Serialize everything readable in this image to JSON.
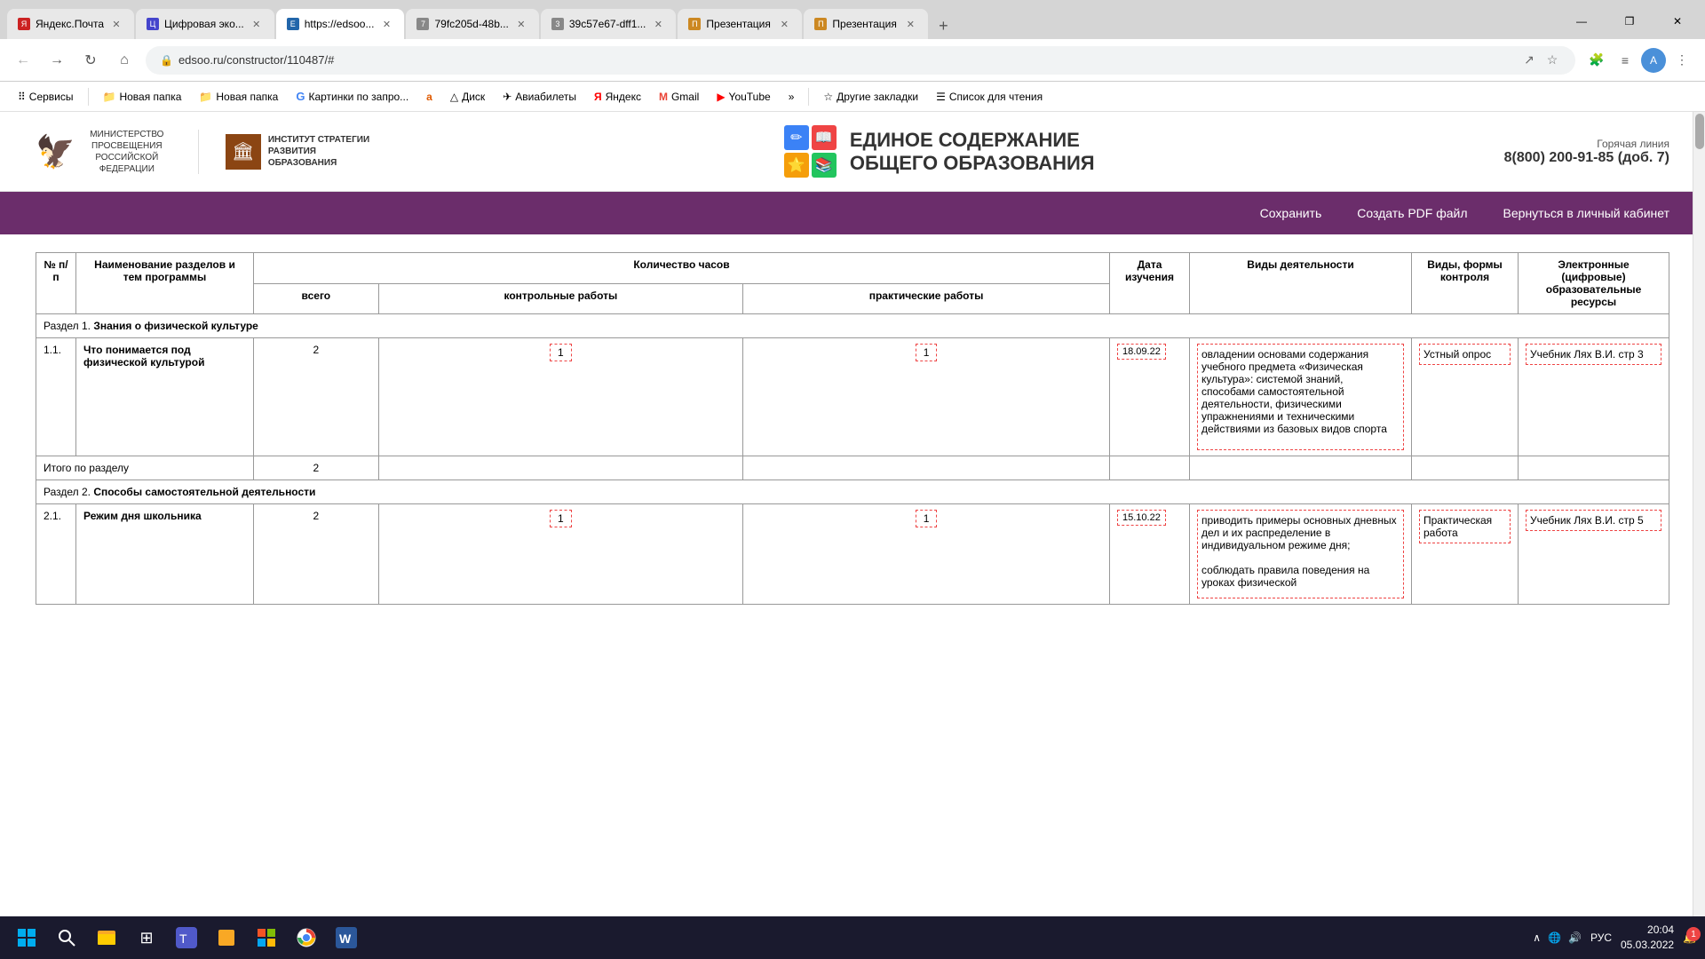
{
  "browser": {
    "tabs": [
      {
        "id": "tab1",
        "title": "Яндекс.Почта",
        "favicon_color": "#cc2222",
        "favicon_char": "Я",
        "active": false
      },
      {
        "id": "tab2",
        "title": "Цифровая эко...",
        "favicon_color": "#4444cc",
        "favicon_char": "Ц",
        "active": false
      },
      {
        "id": "tab3",
        "title": "https://edsoo...",
        "favicon_color": "#2266aa",
        "favicon_char": "E",
        "active": true
      },
      {
        "id": "tab4",
        "title": "79fc205d-48b...",
        "favicon_color": "#888888",
        "favicon_char": "7",
        "active": false
      },
      {
        "id": "tab5",
        "title": "39c57e67-dff1...",
        "favicon_color": "#888888",
        "favicon_char": "3",
        "active": false
      },
      {
        "id": "tab6",
        "title": "Презентация",
        "favicon_color": "#cc8822",
        "favicon_char": "П",
        "active": false
      },
      {
        "id": "tab7",
        "title": "Презентация",
        "favicon_color": "#cc8822",
        "favicon_char": "П",
        "active": false
      }
    ],
    "url": "edsoo.ru/constructor/110487/#",
    "win_min": "—",
    "win_max": "❐",
    "win_close": "✕"
  },
  "bookmarks": [
    {
      "label": "Сервисы",
      "icon": "⠿"
    },
    {
      "label": "Новая папка",
      "icon": "📁"
    },
    {
      "label": "Новая папка",
      "icon": "📁"
    },
    {
      "label": "Картинки по запро...",
      "icon": "G"
    },
    {
      "label": "a",
      "icon": "a"
    },
    {
      "label": "Диск",
      "icon": "△"
    },
    {
      "label": "Авиабилеты",
      "icon": "✈"
    },
    {
      "label": "Яндекс",
      "icon": "Я"
    },
    {
      "label": "Gmail",
      "icon": "M"
    },
    {
      "label": "YouTube",
      "icon": "▶"
    },
    {
      "label": "»",
      "icon": ""
    },
    {
      "label": "Другие закладки",
      "icon": "☆"
    },
    {
      "label": "Список для чтения",
      "icon": "☰"
    }
  ],
  "site": {
    "ministry_logo": "🦅",
    "ministry_text": "МИНИСТЕРСТВО ПРОСВЕЩЕНИЯ РОССИЙСКОЙ ФЕДЕРАЦИИ",
    "institute_text": "ИНСТИТУТ СТРАТЕГИИ РАЗВИТИЯ ОБРАЗОВАНИЯ",
    "title_main": "ЕДИНОЕ СОДЕРЖАНИЕ",
    "title_sub": "ОБЩЕГО ОБРАЗОВАНИЯ",
    "hotline_label": "Горячая линия",
    "hotline_number": "8(800) 200-91-85",
    "hotline_ext": "(доб. 7)",
    "nav_save": "Сохранить",
    "nav_pdf": "Создать PDF файл",
    "nav_back": "Вернуться в личный кабинет"
  },
  "table": {
    "headers": {
      "num": "№ п/п",
      "name": "Наименование разделов и тем программы",
      "hours": "Количество часов",
      "hours_total": "всего",
      "hours_control": "контрольные работы",
      "hours_practice": "практические работы",
      "date": "Дата изучения",
      "activity": "Виды деятельности",
      "control": "Виды, формы контроля",
      "resources": "Электронные (цифровые) образовательные ресурсы"
    },
    "sections": [
      {
        "type": "section",
        "num": "",
        "title": "Раздел 1. Знания о физической культуре",
        "bold_part": "Знания о физической культуре"
      },
      {
        "type": "row",
        "num": "1.1.",
        "name": "Что понимается под физической культурой",
        "hours_total": "2",
        "hours_control": "1",
        "hours_practice": "1",
        "date": "18.09.22",
        "activity": "овладении основами содержания учебного предмета «Физическая культура»: системой знаний, способами самостоятельной деятельности, физическими упражнениями и техническими действиями из базовых видов спорта",
        "control": "Устный опрос",
        "resources": "Учебник Лях В.И. стр 3"
      },
      {
        "type": "total",
        "label": "Итого по разделу",
        "hours_total": "2"
      },
      {
        "type": "section",
        "num": "",
        "title": "Раздел 2. Способы самостоятельной деятельности",
        "bold_part": "Способы самостоятельной деятельности"
      },
      {
        "type": "row",
        "num": "2.1.",
        "name": "Режим дня школьника",
        "hours_total": "2",
        "hours_control": "1",
        "hours_practice": "1",
        "date": "15.10.22",
        "activity": "приводить примеры основных дневных дел и их распределение в индивидуальном режиме дня;\n\nсоблюдать правила поведения на уроках физической",
        "control": "Практическая работа",
        "resources": "Учебник Лях В.И. стр 5"
      }
    ]
  },
  "taskbar": {
    "time": "20:04",
    "date": "05.03.2022",
    "lang": "РУС",
    "notification_count": "1"
  }
}
